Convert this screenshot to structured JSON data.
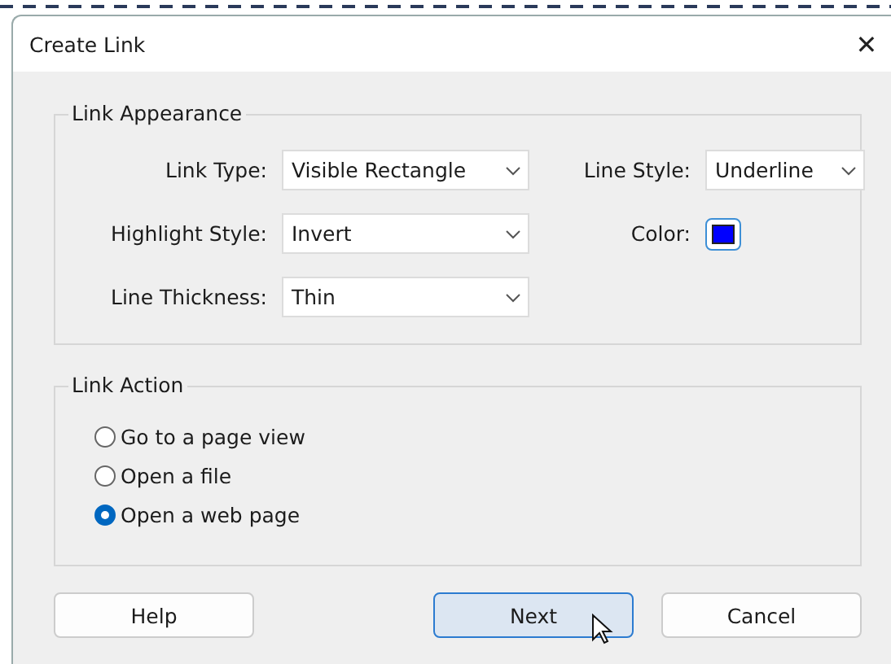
{
  "window": {
    "title": "Create Link",
    "close": "✕"
  },
  "appearance": {
    "title": "Link Appearance",
    "fields": [
      {
        "kind": "select",
        "label": "Link Type:",
        "value": "Visible Rectangle"
      },
      {
        "kind": "select",
        "label": "Line Style:",
        "value": "Underline"
      },
      {
        "kind": "select",
        "label": "Highlight Style:",
        "value": "Invert"
      },
      {
        "kind": "color",
        "label": "Color:",
        "color": "#0000ff"
      },
      {
        "kind": "select",
        "label": "Line Thickness:",
        "value": "Thin"
      }
    ]
  },
  "action": {
    "title": "Link Action",
    "options": [
      {
        "label": "Go to a page view",
        "selected": false
      },
      {
        "label": "Open a file",
        "selected": false
      },
      {
        "label": "Open a web page",
        "selected": true
      }
    ]
  },
  "buttons": [
    {
      "label": "Help",
      "default": false
    },
    {
      "label": "Next",
      "default": true
    },
    {
      "label": "Cancel",
      "default": false
    }
  ]
}
